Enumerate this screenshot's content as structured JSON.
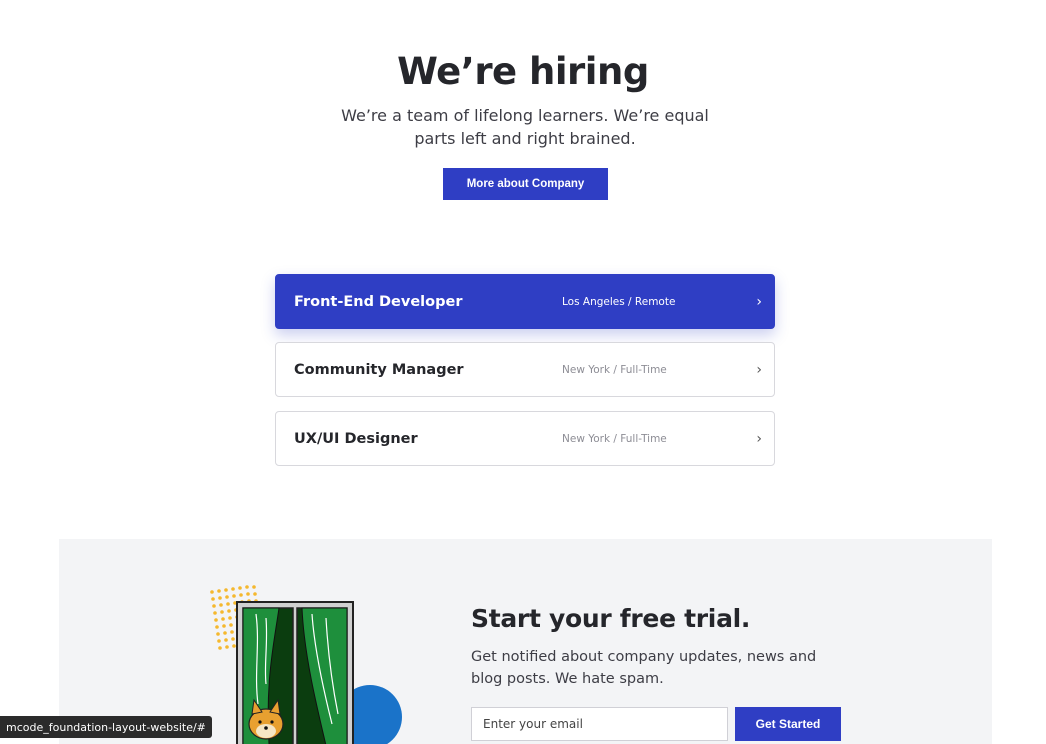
{
  "hero": {
    "title": "We’re hiring",
    "subtitle": "We’re a team of lifelong learners. We’re equal parts left and right brained.",
    "button_label": "More about Company"
  },
  "jobs": [
    {
      "title": "Front-End Developer",
      "location": "Los Angeles / Remote",
      "active": true
    },
    {
      "title": "Community Manager",
      "location": "New York / Full-Time",
      "active": false
    },
    {
      "title": "UX/UI Designer",
      "location": "New York / Full-Time",
      "active": false
    }
  ],
  "chevron": "›",
  "trial": {
    "title": "Start your free trial.",
    "description": "Get notified about company updates, news and blog posts. We hate spam.",
    "email_placeholder": "Enter your email",
    "button_label": "Get Started"
  },
  "status_bar": {
    "url": "mcode_foundation-layout-website/#"
  },
  "colors": {
    "accent": "#2f3ec4",
    "section_bg": "#f3f4f6",
    "dots": "#f5b82e",
    "curtain": "#1e8f3c",
    "blob": "#1a73c9"
  }
}
